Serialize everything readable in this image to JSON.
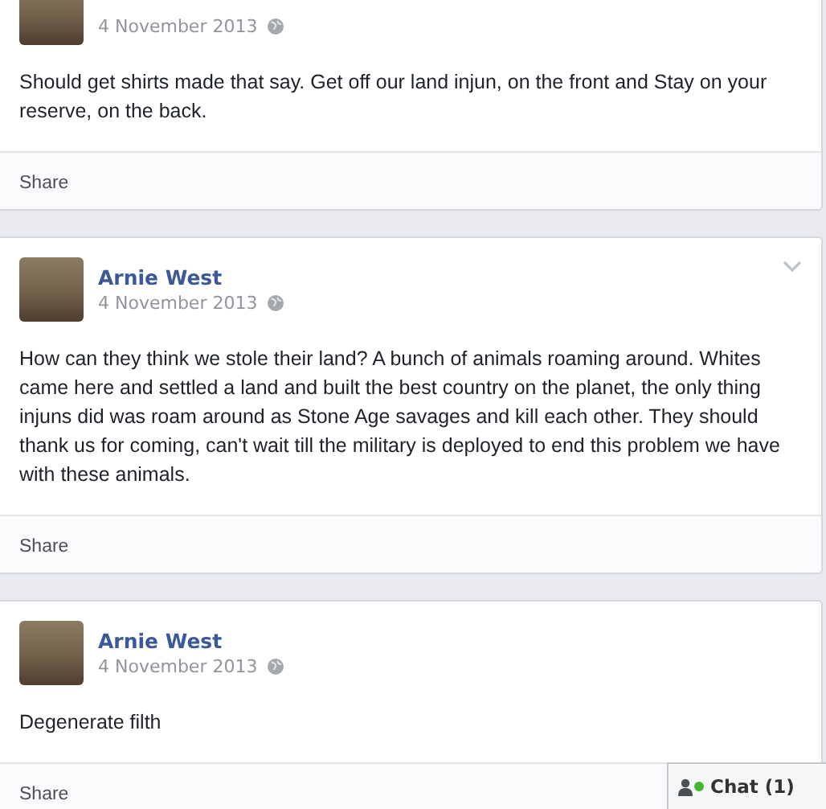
{
  "posts": [
    {
      "date": "4 November 2013",
      "text": "Should get shirts made that say. Get off our land injun, on the front and Stay on your reserve, on the back.",
      "menu_caret": false,
      "action": "Share"
    },
    {
      "author": "Arnie West",
      "date": "4 November 2013",
      "text": "How can they think we stole their land? A bunch of animals roaming around. Whites came here and settled a land and built the best country on the planet, the only thing injuns did was roam around as Stone Age savages and kill each other. They should thank us for coming, can't wait till the military is deployed to end this problem we have with these animals.",
      "menu_caret": true,
      "action": "Share"
    },
    {
      "author": "Arnie West",
      "date": "4 November 2013",
      "text": "Degenerate filth",
      "menu_caret": false,
      "action": "Share"
    }
  ],
  "chat": {
    "label": "Chat (1)",
    "online": true
  }
}
